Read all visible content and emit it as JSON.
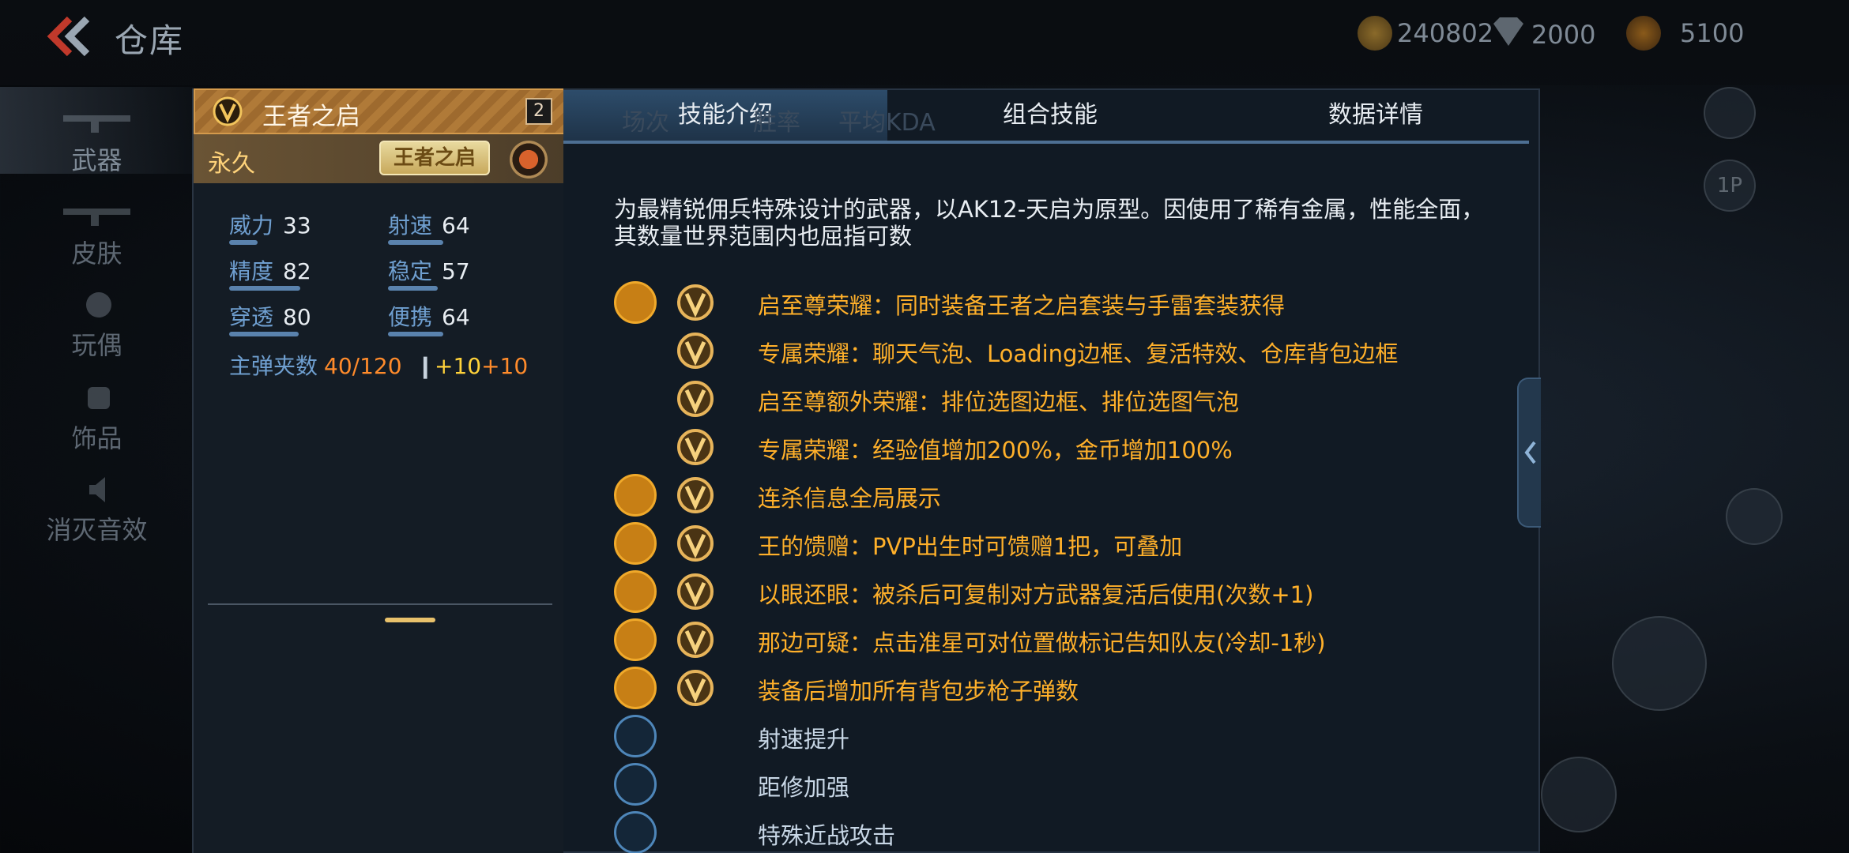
{
  "header": {
    "title": "仓库",
    "currencies": [
      {
        "icon": "gold-coin-icon",
        "value": "240802"
      },
      {
        "icon": "diamond-icon",
        "value": "2000"
      },
      {
        "icon": "medal-coin-icon",
        "value": "5100"
      }
    ]
  },
  "sidebar": {
    "items": [
      {
        "label": "武器",
        "active": true
      },
      {
        "label": "皮肤"
      },
      {
        "label": "玩偶"
      },
      {
        "label": "饰品"
      },
      {
        "label": "消灭音效"
      }
    ]
  },
  "weapon": {
    "name": "王者之启",
    "count": "2",
    "duration": "永久",
    "logo_text": "王者之启",
    "stats": [
      {
        "name": "威力",
        "value": "33",
        "fill": 0.33
      },
      {
        "name": "射速",
        "value": "64",
        "fill": 0.64
      },
      {
        "name": "精度",
        "value": "82",
        "fill": 0.82
      },
      {
        "name": "稳定",
        "value": "57",
        "fill": 0.57
      },
      {
        "name": "穿透",
        "value": "80",
        "fill": 0.8
      },
      {
        "name": "便携",
        "value": "64",
        "fill": 0.64
      }
    ],
    "ammo_label": "主弹夹数",
    "ammo_value": "40/120",
    "ammo_bonus_1": "+10",
    "ammo_bonus_2": "+10"
  },
  "tabs": [
    {
      "label": "技能介绍",
      "active": true
    },
    {
      "label": "组合技能"
    },
    {
      "label": "数据详情"
    }
  ],
  "ghost_text": [
    "场次",
    "胜率",
    "平均KDA"
  ],
  "description": "为最精锐佣兵特殊设计的武器，以AK12-天启为原型。因使用了稀有金属，性能全面，其数量世界范围内也屈指可数",
  "skills": [
    {
      "icon": "diamond-lattice-icon",
      "text": "启至尊荣耀：同时装备王者之启套装与手雷套装获得",
      "style": "gold",
      "has_badge": true
    },
    {
      "icon": "",
      "text": "专属荣耀：聊天气泡、Loading边框、复活特效、仓库背包边框",
      "style": "gold",
      "has_badge": true
    },
    {
      "icon": "",
      "text": "启至尊额外荣耀：排位选图边框、排位选图气泡",
      "style": "gold",
      "has_badge": true
    },
    {
      "icon": "",
      "text": "专属荣耀：经验值增加200%，金币增加100%",
      "style": "gold",
      "has_badge": true
    },
    {
      "icon": "broadcast-icon",
      "text": "连杀信息全局展示",
      "style": "gold",
      "has_badge": true
    },
    {
      "icon": "gift-icon",
      "text": "王的馈赠：PVP出生时可馈赠1把，可叠加",
      "style": "gold",
      "has_badge": true
    },
    {
      "icon": "copy-weapon-icon",
      "text": "以眼还眼：被杀后可复制对方武器复活后使用(次数+1)",
      "style": "gold",
      "has_badge": true
    },
    {
      "icon": "running-man-icon",
      "text": "那边可疑：点击准星可对位置做标记告知队友(冷却-1秒)",
      "style": "gold",
      "has_badge": true
    },
    {
      "icon": "ammo-pack-icon",
      "text": "装备后增加所有背包步枪子弹数",
      "style": "gold",
      "has_badge": true
    },
    {
      "icon": "fire-rate-icon",
      "text": "射速提升",
      "style": "blue",
      "has_badge": false
    },
    {
      "icon": "range-icon",
      "text": "距修加强",
      "style": "blue",
      "has_badge": false
    },
    {
      "icon": "melee-icon",
      "text": "特殊近战攻击",
      "style": "blue",
      "has_badge": false
    }
  ]
}
